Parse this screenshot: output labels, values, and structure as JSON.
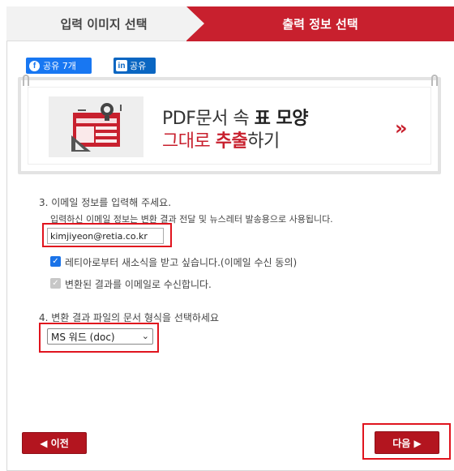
{
  "steps": {
    "step1_label": "입력 이미지 선택",
    "step2_label": "출력 정보 선택"
  },
  "share": {
    "facebook_label": "공유 7개",
    "linkedin_label": "공유",
    "facebook_icon": "f",
    "linkedin_icon": "in"
  },
  "banner": {
    "line1_a": "PDF문서 속 ",
    "line1_b": "표 모양",
    "line2_a": "그대로 ",
    "line2_b": "추출",
    "line2_c": "하기",
    "arrow": "»"
  },
  "email_section": {
    "title": "3. 이메일 정보를 입력해 주세요.",
    "description": "입력하신 이메일 정보는 변환 결과 전달 및 뉴스레터 발송용으로 사용됩니다.",
    "email_value": "kimjiyeon@retia.co.kr",
    "newsletter_label": "레티아로부터 새소식을 받고 싶습니다.(이메일 수신 동의)",
    "newsletter_checked": true,
    "receive_result_label": "변환된 결과를 이메일로 수신합니다.",
    "receive_result_checked": true
  },
  "format_section": {
    "title": "4. 변환 결과 파일의 문서 형식을 선택하세요",
    "selected": "MS 워드 (doc)"
  },
  "nav": {
    "prev_label": "◀ 이전",
    "next_label": "다음 ▶"
  },
  "colors": {
    "accent": "#c8202e",
    "button": "#b3151f",
    "highlight_border": "#e0141e",
    "facebook": "#1877f2",
    "linkedin": "#0a66c2"
  }
}
